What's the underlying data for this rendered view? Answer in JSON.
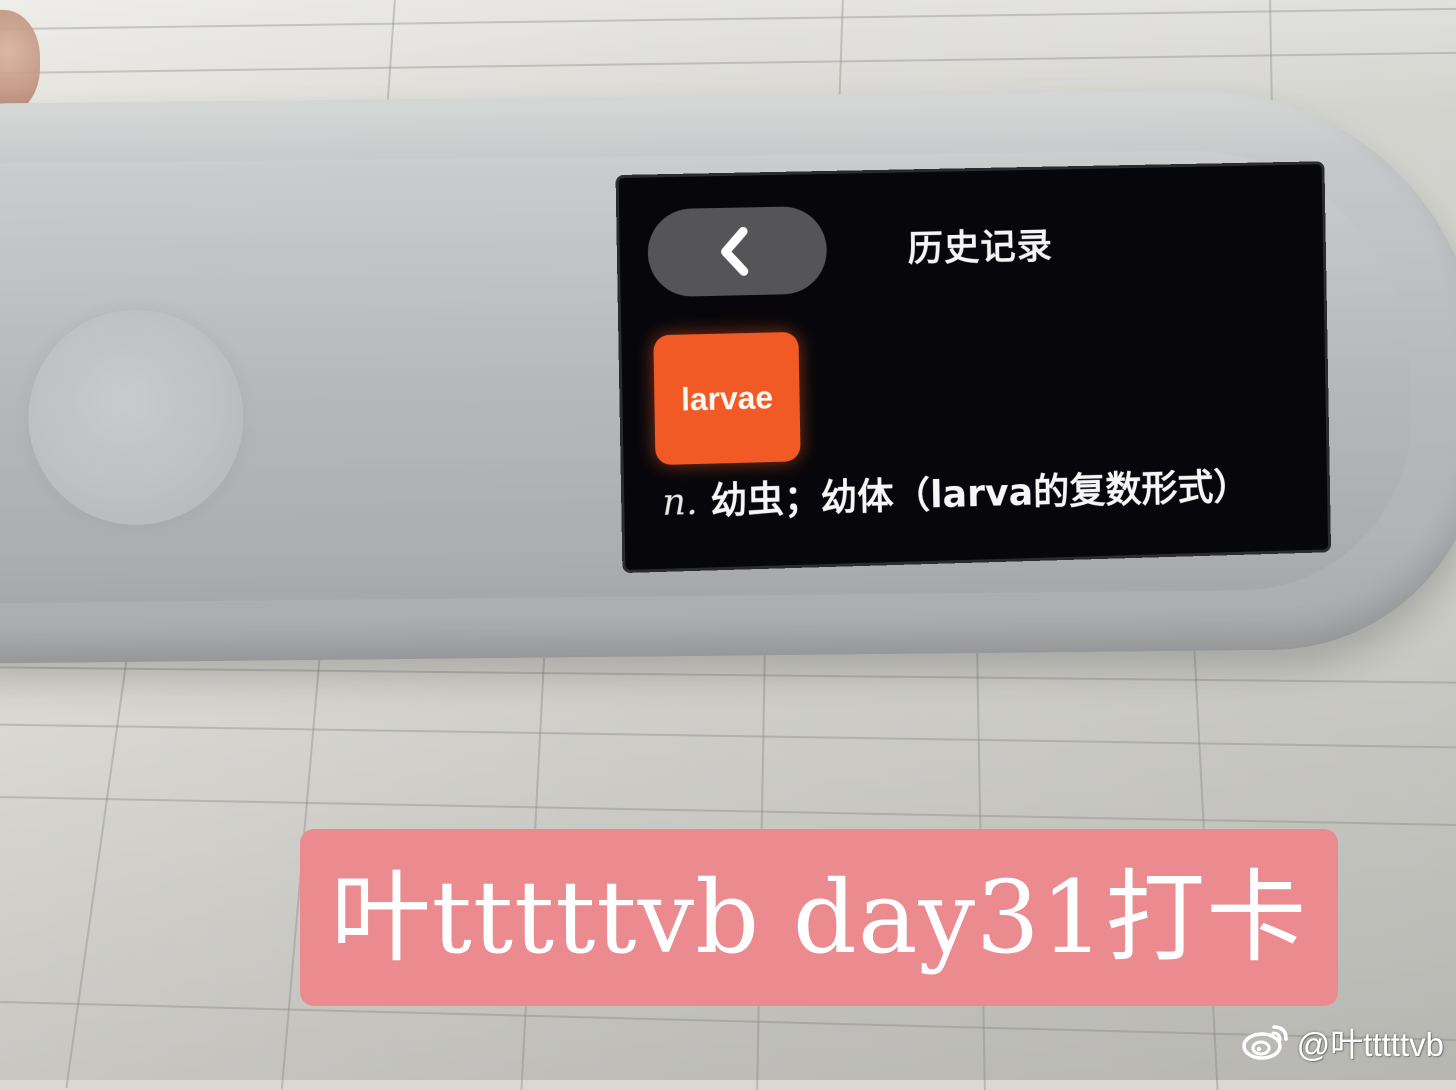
{
  "device_screen": {
    "title": "历史记录",
    "back_icon": "chevron-left-icon",
    "word": "larvae",
    "definition_pos": "n.",
    "definition_text": "幼虫；幼体（larva的复数形式）"
  },
  "caption": {
    "text": "叶tttttvb day31打卡"
  },
  "watermark": {
    "icon": "weibo-icon",
    "handle": "@叶tttttvb"
  },
  "colors": {
    "word_tile": "#f15a24",
    "caption_background": "#eb8a8f",
    "screen_background": "#07070b"
  }
}
